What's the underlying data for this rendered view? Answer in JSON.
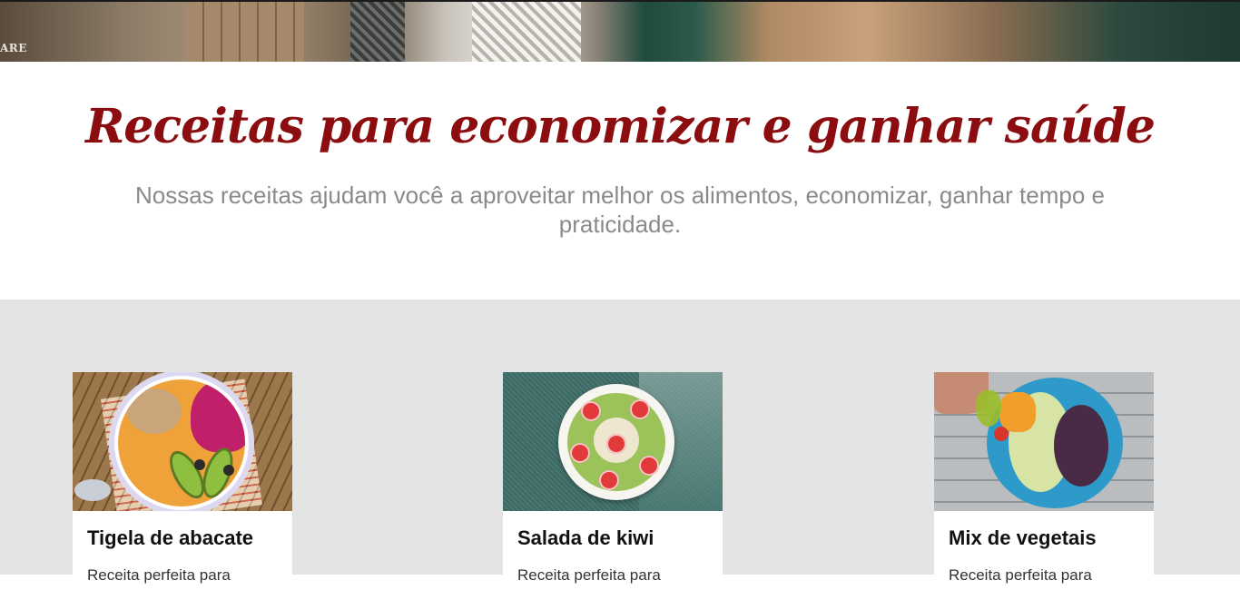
{
  "hero": {
    "tag_text": "ARE",
    "image_icon": "market-crates-photo"
  },
  "intro": {
    "title": "Receitas para economizar e ganhar saúde",
    "subtitle": "Nossas receitas ajudam você a aproveitar melhor os alimentos, economizar, ganhar tempo e praticidade."
  },
  "colors": {
    "title": "#8b0d10",
    "subtitle": "#8a8a8a",
    "section_bg": "#e4e4e4",
    "card_bg": "#ffffff"
  },
  "recipes": [
    {
      "title": "Tigela de abacate",
      "desc": "Receita perfeita para",
      "image_icon": "avocado-bowl-photo"
    },
    {
      "title": "Salada de kiwi",
      "desc": "Receita perfeita para",
      "image_icon": "kiwi-salad-photo"
    },
    {
      "title": "Mix de vegetais",
      "desc": "Receita perfeita para",
      "image_icon": "vegetable-mix-photo"
    }
  ]
}
